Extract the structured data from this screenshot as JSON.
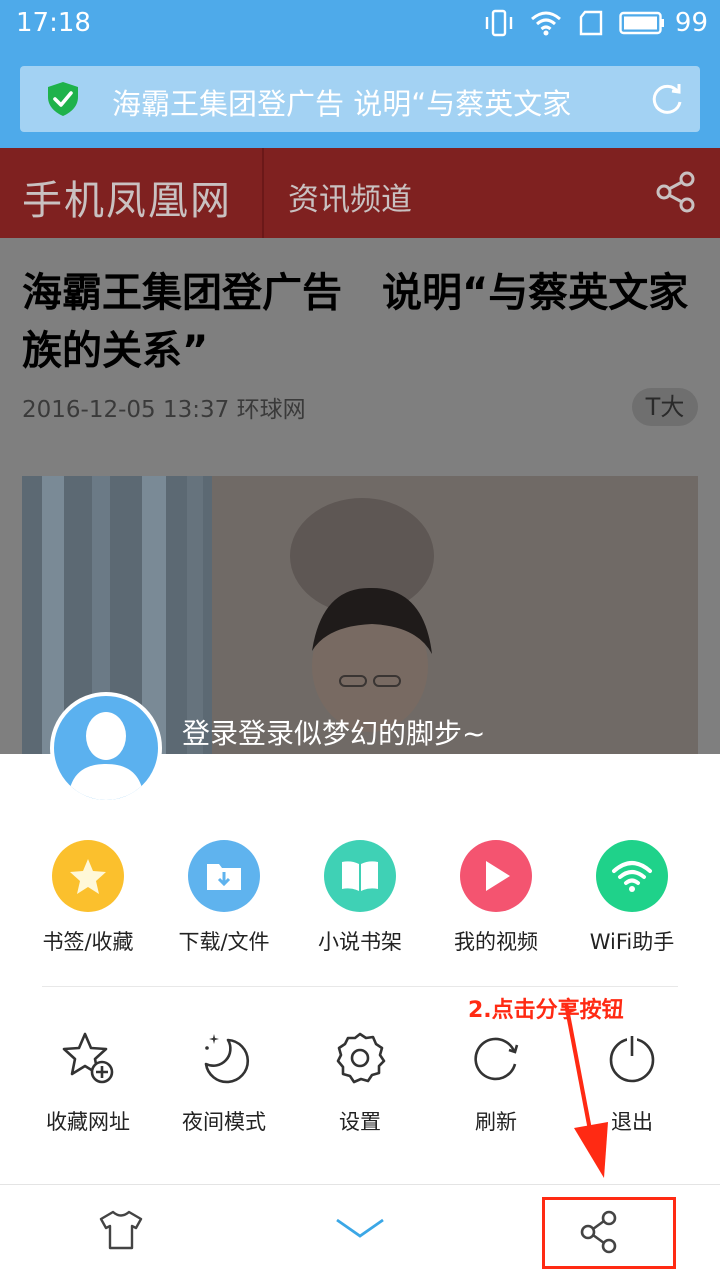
{
  "status_bar": {
    "time": "17:18",
    "battery": "99"
  },
  "url_bar": {
    "title": "海霸王集团登广告 说明“与蔡英文家"
  },
  "site_header": {
    "logo": "手机凤凰网",
    "channel": "资讯频道"
  },
  "article": {
    "title": "海霸王集团登广告　说明“与蔡英文家族的关系”",
    "meta": "2016-12-05 13:37 环球网",
    "font_button": "T大"
  },
  "menu": {
    "login_prompt": "登录登录似梦幻的脚步~",
    "row1": [
      {
        "label": "书签/收藏",
        "icon": "star-icon",
        "color": "#fbc02d"
      },
      {
        "label": "下载/文件",
        "icon": "download-folder-icon",
        "color": "#5fb3ee"
      },
      {
        "label": "小说书架",
        "icon": "book-icon",
        "color": "#3fd1b5"
      },
      {
        "label": "我的视频",
        "icon": "play-icon",
        "color": "#f45470"
      },
      {
        "label": "WiFi助手",
        "icon": "wifi-icon",
        "color": "#1fd28a"
      }
    ],
    "row2": [
      {
        "label": "收藏网址",
        "icon": "add-bookmark-icon"
      },
      {
        "label": "夜间模式",
        "icon": "moon-icon"
      },
      {
        "label": "设置",
        "icon": "gear-icon"
      },
      {
        "label": "刷新",
        "icon": "refresh-icon"
      },
      {
        "label": "退出",
        "icon": "power-icon"
      }
    ]
  },
  "annotation": {
    "text": "2.点击分享按钮",
    "color": "#ff2a13"
  },
  "bottom_bar": {
    "items": [
      "shirt-icon",
      "collapse-icon",
      "share-icon"
    ]
  }
}
